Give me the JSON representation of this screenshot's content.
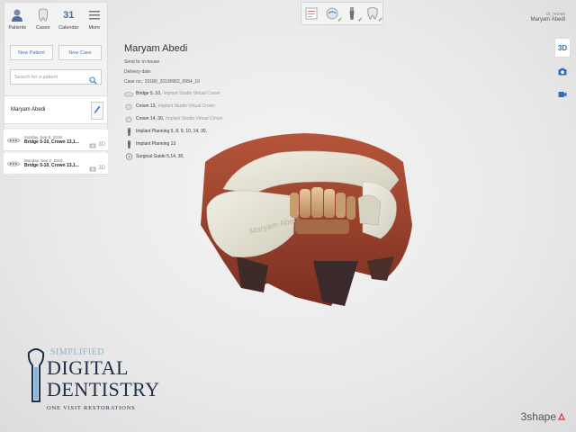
{
  "nav": {
    "items": [
      {
        "label": "Patients",
        "icon": "patients-icon"
      },
      {
        "label": "Cases",
        "icon": "cases-icon"
      },
      {
        "label": "Calendar",
        "icon": "calendar-icon",
        "number": "31"
      },
      {
        "label": "More",
        "icon": "menu-icon"
      }
    ]
  },
  "actions": {
    "new_patient": "New Patient",
    "new_case": "New Case"
  },
  "search": {
    "placeholder": "Search for a patient"
  },
  "patient": {
    "name": "Maryam Abedi"
  },
  "cases": [
    {
      "date": "Sunday, Sep 8, 2019",
      "title": "Bridge 5-10, Crown 13,1...",
      "badge": "3D"
    },
    {
      "date": "Monday, Sep 2, 2019",
      "title": "Bridge 5-10, Crown 13,1...",
      "badge": "3D"
    }
  ],
  "user": {
    "login": "dr_rezaei",
    "name": "Maryam Abedi"
  },
  "sidebar_right": {
    "view_3d": "3D"
  },
  "case_info": {
    "name": "Maryam Abedi",
    "send_to": "Send to: in-house",
    "delivery": "Delivery date:",
    "case_no": "Case no.: 20180_20190902_0954_10",
    "items": [
      {
        "label": "Bridge 5..10,",
        "sub": "Implant Studio Virtual Crown"
      },
      {
        "label": "Crown 13,",
        "sub": "Implant Studio Virtual Crown"
      },
      {
        "label": "Crown 14, 30,",
        "sub": "Implant Studio Virtual Crown"
      },
      {
        "label": "Implant Planning 5, 8, 9, 10, 14, 30,",
        "sub": ""
      },
      {
        "label": "Implant Planning 13",
        "sub": ""
      },
      {
        "label": "Surgical Guide 5,14, 30,",
        "sub": ""
      }
    ]
  },
  "logo": {
    "simplified": "SIMPLIFIED",
    "digital": "DIGITAL",
    "dentistry": "DENTISTRY",
    "tagline": "ONE VISIT RESTORATIONS"
  },
  "brand": {
    "name": "3shape"
  },
  "model_label": "Maryam Abedi",
  "colors": {
    "accent": "#2f6fba",
    "check": "#5aa53a",
    "logo_navy": "#1f2f4a",
    "logo_light": "#7eb8e0"
  }
}
